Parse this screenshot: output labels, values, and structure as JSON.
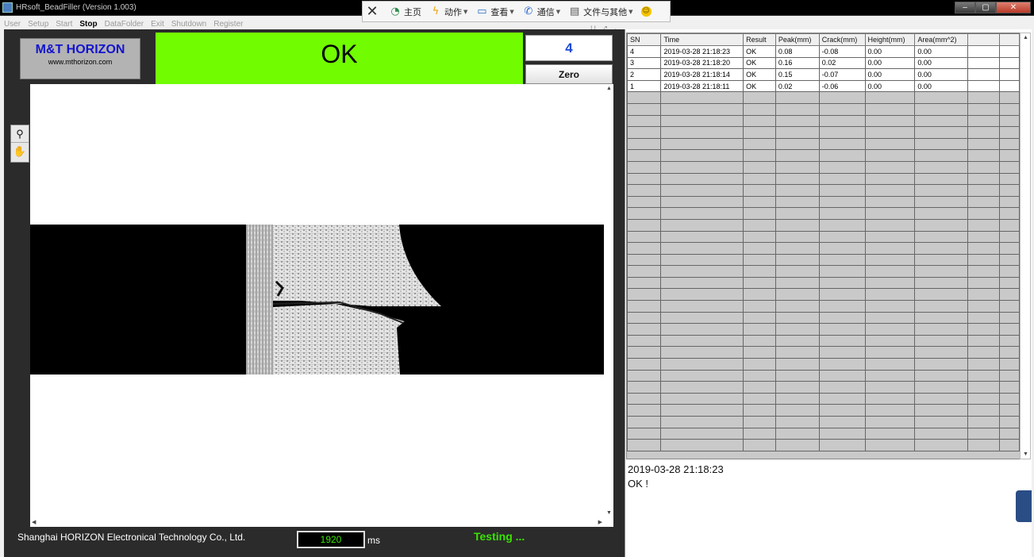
{
  "window": {
    "title": "HRsoft_BeadFiller (Version 1.003)",
    "controls": [
      "–",
      "▢",
      "✕"
    ]
  },
  "menu": [
    {
      "label": "User",
      "active": false
    },
    {
      "label": "Setup",
      "active": false
    },
    {
      "label": "Start",
      "active": false
    },
    {
      "label": "Stop",
      "active": true
    },
    {
      "label": "DataFolder",
      "active": false
    },
    {
      "label": "Exit",
      "active": false
    },
    {
      "label": "Shutdown",
      "active": false
    },
    {
      "label": "Register",
      "active": false
    }
  ],
  "cn_toolbar": {
    "items": [
      {
        "label": "主页",
        "icon": "home-refresh-icon"
      },
      {
        "label": "动作",
        "icon": "lightning-icon",
        "dropdown": true
      },
      {
        "label": "查看",
        "icon": "monitor-icon",
        "dropdown": true
      },
      {
        "label": "通信",
        "icon": "phone-icon",
        "dropdown": true
      },
      {
        "label": "文件与其他",
        "icon": "file-icon",
        "dropdown": true
      }
    ]
  },
  "logo": {
    "brand": "M&T HORIZON",
    "url": "www.mthorizon.com"
  },
  "result": {
    "text": "OK",
    "color": "#72fc00"
  },
  "counter": {
    "value": "4",
    "zero_label": "Zero"
  },
  "footer": {
    "company": "Shanghai HORIZON Electronical Technology Co., Ltd.",
    "timer_value": "1920",
    "timer_unit": "ms",
    "status": "Testing ..."
  },
  "table": {
    "headers": [
      "SN",
      "Time",
      "Result",
      "Peak(mm)",
      "Crack(mm)",
      "Height(mm)",
      "Area(mm^2)",
      "",
      ""
    ],
    "rows": [
      [
        "4",
        "2019-03-28 21:18:23",
        "OK",
        "0.08",
        "-0.08",
        "0.00",
        "0.00",
        "",
        ""
      ],
      [
        "3",
        "2019-03-28 21:18:20",
        "OK",
        "0.16",
        "0.02",
        "0.00",
        "0.00",
        "",
        ""
      ],
      [
        "2",
        "2019-03-28 21:18:14",
        "OK",
        "0.15",
        "-0.07",
        "0.00",
        "0.00",
        "",
        ""
      ],
      [
        "1",
        "2019-03-28 21:18:11",
        "OK",
        "0.02",
        "-0.06",
        "0.00",
        "0.00",
        "",
        ""
      ]
    ]
  },
  "log": {
    "timestamp": "2019-03-28 21:18:23",
    "message": "OK !"
  }
}
